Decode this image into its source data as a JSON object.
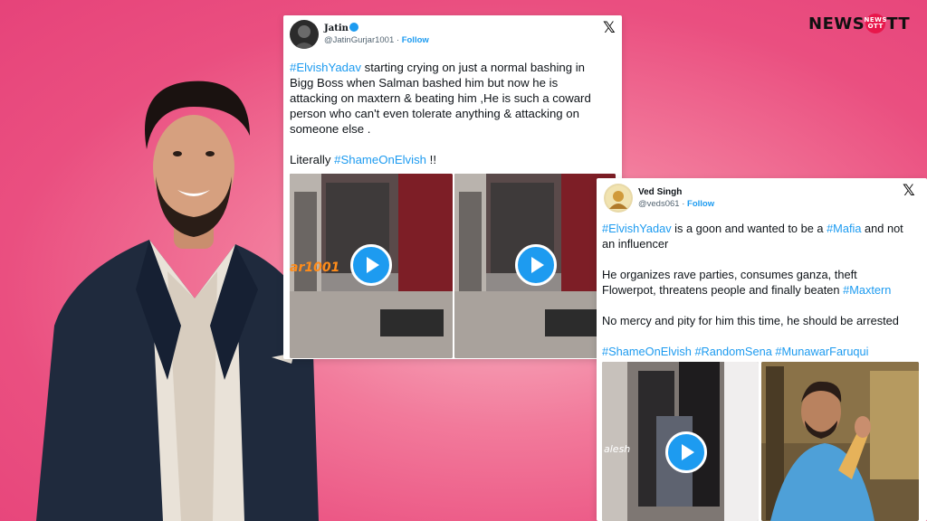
{
  "brand": {
    "logo_left": "NEWS",
    "badge_top": "NEWS",
    "badge_bottom": "OTT",
    "logo_right": "TT"
  },
  "tweet1": {
    "display_name": "Jatin",
    "handle": "@JatinGurjar1001",
    "separator": "·",
    "follow": "Follow",
    "x_icon": "𝕏",
    "lines": [
      {
        "hash": "#ElvishYadav",
        "text": " starting crying on just a normal bashing in"
      },
      {
        "hash": "",
        "text": "Bigg Boss when Salman bashed him but now he is"
      },
      {
        "hash": "",
        "text": "attacking on maxtern & beating him ,He is such a coward"
      },
      {
        "hash": "",
        "text": "person who can't even tolerate anything & attacking on"
      },
      {
        "hash": "",
        "text": "someone else ."
      }
    ],
    "literally": "Literally ",
    "shame_tag": "#ShameOnElvish",
    "tail": " !!",
    "media_overlay": "ar1001"
  },
  "tweet2": {
    "display_name": "Ved Singh",
    "handle": "@veds061",
    "separator": "·",
    "follow": "Follow",
    "x_icon": "𝕏",
    "line1_tag": "#ElvishYadav",
    "line1_text": " is a goon and wanted to be a ",
    "line1_tag2": "#Mafia",
    "line1_tail": " and not",
    "line2": "an influencer",
    "para2_line1": "He organizes rave parties, consumes ganza, theft",
    "para2_line2": "Flowerpot, threatens people and finally beaten ",
    "para2_tag": "#Maxtern",
    "para3": "No mercy and pity for him this time, he should be arrested",
    "tags": [
      "#ShameOnElvish",
      "#RandomSena",
      "#MunawarFaruqui"
    ],
    "media_overlay": "alesh"
  },
  "colors": {
    "accent": "#1d9bf0",
    "brand_red": "#e8174b",
    "bg_pink": "#ea4f80"
  }
}
